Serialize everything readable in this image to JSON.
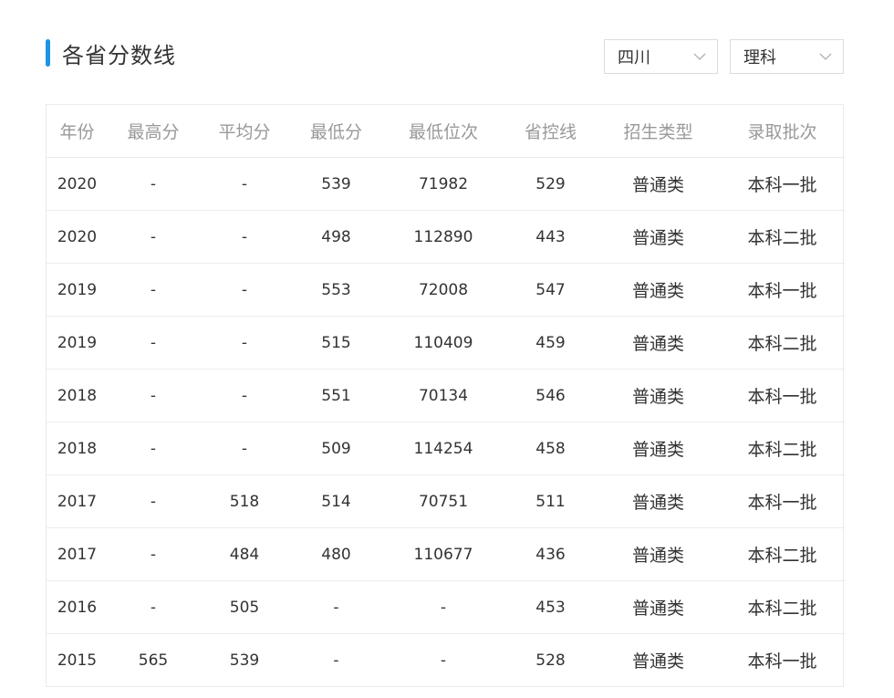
{
  "colors": {
    "accent": "#1a96e0"
  },
  "title": "各省分数线",
  "filters": {
    "province": "四川",
    "subject": "理科",
    "dropdown_icon": "chevron-down-icon"
  },
  "table": {
    "headers": [
      "年份",
      "最高分",
      "平均分",
      "最低分",
      "最低位次",
      "省控线",
      "招生类型",
      "录取批次"
    ],
    "rows": [
      [
        "2020",
        "-",
        "-",
        "539",
        "71982",
        "529",
        "普通类",
        "本科一批"
      ],
      [
        "2020",
        "-",
        "-",
        "498",
        "112890",
        "443",
        "普通类",
        "本科二批"
      ],
      [
        "2019",
        "-",
        "-",
        "553",
        "72008",
        "547",
        "普通类",
        "本科一批"
      ],
      [
        "2019",
        "-",
        "-",
        "515",
        "110409",
        "459",
        "普通类",
        "本科二批"
      ],
      [
        "2018",
        "-",
        "-",
        "551",
        "70134",
        "546",
        "普通类",
        "本科一批"
      ],
      [
        "2018",
        "-",
        "-",
        "509",
        "114254",
        "458",
        "普通类",
        "本科二批"
      ],
      [
        "2017",
        "-",
        "518",
        "514",
        "70751",
        "511",
        "普通类",
        "本科一批"
      ],
      [
        "2017",
        "-",
        "484",
        "480",
        "110677",
        "436",
        "普通类",
        "本科二批"
      ],
      [
        "2016",
        "-",
        "505",
        "-",
        "-",
        "453",
        "普通类",
        "本科二批"
      ],
      [
        "2015",
        "565",
        "539",
        "-",
        "-",
        "528",
        "普通类",
        "本科一批"
      ]
    ]
  }
}
